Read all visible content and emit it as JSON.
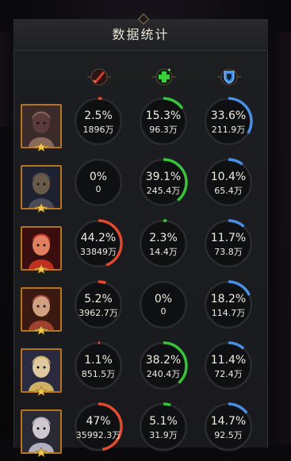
{
  "window": {
    "title": "数据统计"
  },
  "columns": [
    {
      "icon": "damage-sword-icon",
      "color": "#e04a2e"
    },
    {
      "icon": "heal-cross-icon",
      "color": "#38c43a"
    },
    {
      "icon": "shield-icon",
      "color": "#4a8ee6"
    }
  ],
  "rows": [
    {
      "hero": "dragon-helm-warrior",
      "stats": [
        {
          "pct": "2.5%",
          "val": "1896万",
          "fill": 0.025
        },
        {
          "pct": "15.3%",
          "val": "96.3万",
          "fill": 0.153
        },
        {
          "pct": "33.6%",
          "val": "211.9万",
          "fill": 0.336
        }
      ]
    },
    {
      "hero": "dark-hooded-rogue",
      "stats": [
        {
          "pct": "0%",
          "val": "0",
          "fill": 0
        },
        {
          "pct": "39.1%",
          "val": "245.4万",
          "fill": 0.391
        },
        {
          "pct": "10.4%",
          "val": "65.4万",
          "fill": 0.104
        }
      ]
    },
    {
      "hero": "red-haired-queen",
      "stats": [
        {
          "pct": "44.2%",
          "val": "33849万",
          "fill": 0.442
        },
        {
          "pct": "2.3%",
          "val": "14.4万",
          "fill": 0.023
        },
        {
          "pct": "11.7%",
          "val": "73.8万",
          "fill": 0.117
        }
      ]
    },
    {
      "hero": "turbaned-sultan",
      "stats": [
        {
          "pct": "5.2%",
          "val": "3962.7万",
          "fill": 0.052
        },
        {
          "pct": "0%",
          "val": "0",
          "fill": 0
        },
        {
          "pct": "18.2%",
          "val": "114.7万",
          "fill": 0.182
        }
      ]
    },
    {
      "hero": "blonde-priestess",
      "stats": [
        {
          "pct": "1.1%",
          "val": "851.5万",
          "fill": 0.011
        },
        {
          "pct": "38.2%",
          "val": "240.4万",
          "fill": 0.382
        },
        {
          "pct": "11.4%",
          "val": "72.4万",
          "fill": 0.114
        }
      ]
    },
    {
      "hero": "silver-crowned-elf",
      "stats": [
        {
          "pct": "47%",
          "val": "35992.3万",
          "fill": 0.47
        },
        {
          "pct": "5.1%",
          "val": "31.9万",
          "fill": 0.051
        },
        {
          "pct": "14.7%",
          "val": "92.5万",
          "fill": 0.147
        }
      ]
    }
  ]
}
